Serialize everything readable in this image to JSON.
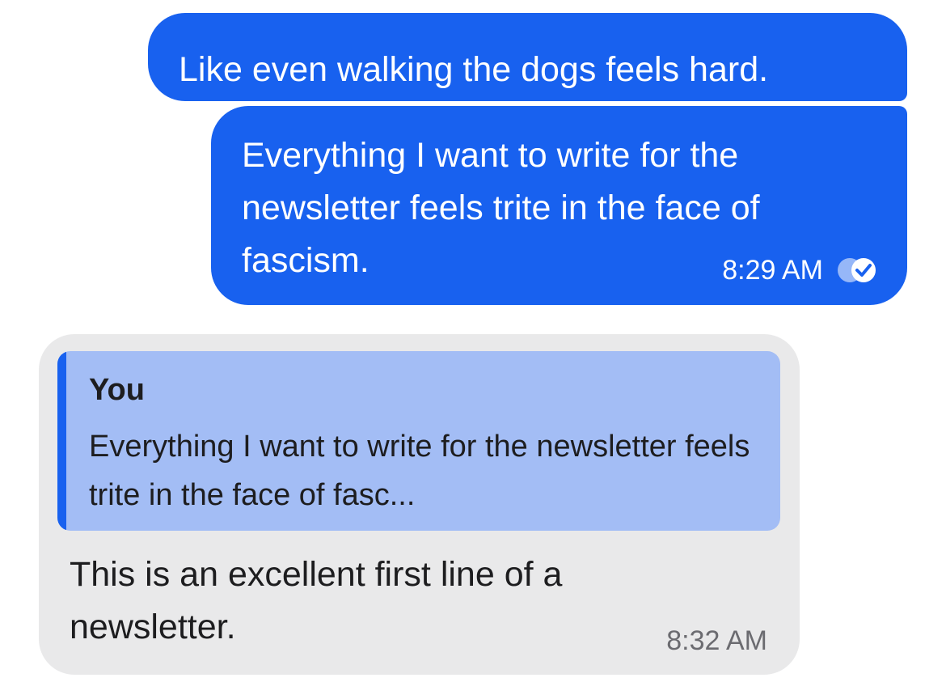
{
  "messages": {
    "outgoing_1": {
      "text": "Like even walking the dogs feels hard."
    },
    "outgoing_2": {
      "text": "Everything I want to write for the newsletter feels trite in the face of fascism.",
      "time": "8:29 AM",
      "status_icon": "double-check-icon"
    },
    "incoming_1": {
      "quote_author": "You",
      "quote_text": "Everything I want to write for the newsletter feels trite in the face of fasc...",
      "text": "This is an excellent first line of a newsletter.",
      "time": "8:32 AM"
    }
  },
  "colors": {
    "outgoing_bubble": "#1861ef",
    "incoming_bubble": "#e9e9ea",
    "quote_background": "#a3bdf5",
    "quote_bar": "#1861ef"
  }
}
